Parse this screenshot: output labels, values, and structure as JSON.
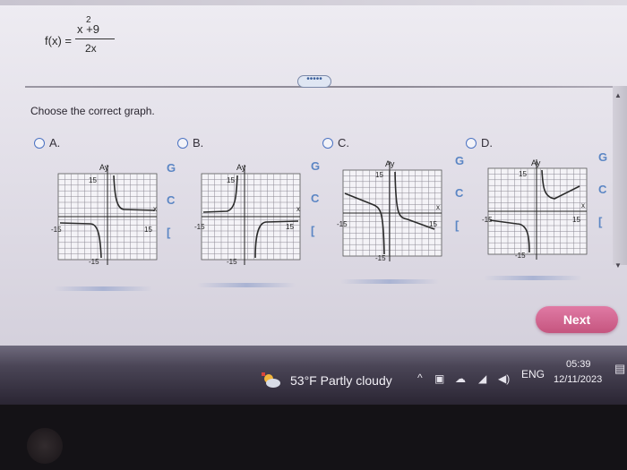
{
  "formula": {
    "lhs": "f(x) =",
    "numerator": "x  +9",
    "exponent": "2",
    "denominator": "2x"
  },
  "more_label": "•••••",
  "prompt": "Choose the correct graph.",
  "options": [
    {
      "letter": "A.",
      "tick_neg": "-15",
      "tick_pos": "15",
      "top": "15",
      "bottom": "-15",
      "y_label": "Ay",
      "x_label": "x"
    },
    {
      "letter": "B.",
      "tick_neg": "-15",
      "tick_pos": "15",
      "top": "15",
      "bottom": "-15",
      "y_label": "Ay",
      "x_label": "x"
    },
    {
      "letter": "C.",
      "tick_neg": "-15",
      "tick_pos": "15",
      "top": "15",
      "bottom": "-15",
      "y_label": "Ay",
      "x_label": "x"
    },
    {
      "letter": "D.",
      "tick_neg": "-15",
      "tick_pos": "15",
      "top": "15",
      "bottom": "-15",
      "y_label": "Ay",
      "x_label": "x"
    }
  ],
  "next_label": "Next",
  "taskbar": {
    "weather": "53°F  Partly cloudy",
    "language": "ENG",
    "time": "05:39",
    "date": "12/11/2023"
  },
  "colors": {
    "accent": "#4c73c2",
    "next_button": "#d5668f",
    "taskbar": "#3a3545"
  }
}
